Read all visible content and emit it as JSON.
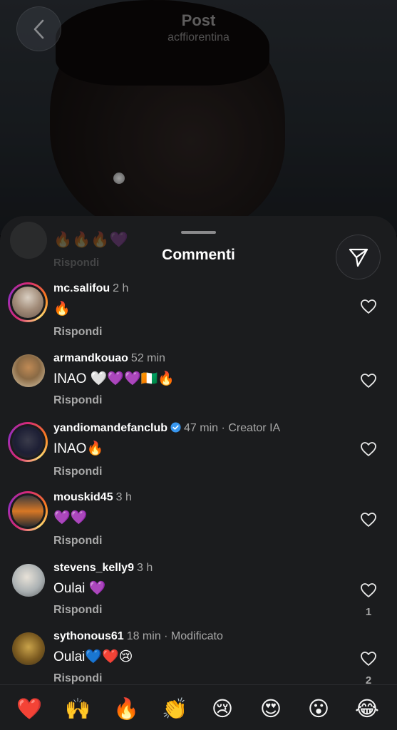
{
  "header": {
    "title": "Post",
    "subtitle": "acffiorentina"
  },
  "sheet": {
    "title": "Commenti",
    "ghost_emojis": "🔥🔥🔥💜",
    "ghost_reply": "Rispondi"
  },
  "comments": [
    {
      "username": "mc.salifou",
      "time": "2 h",
      "text": "🔥",
      "reply": "Rispondi",
      "likes": ""
    },
    {
      "username": "armandkouao",
      "time": "52 min",
      "text": "INAO 🤍💜💜🇨🇮🔥",
      "reply": "Rispondi",
      "likes": ""
    },
    {
      "username": "yandiomandefanclub",
      "time": "47 min · Creator IA",
      "text": "INAO🔥",
      "reply": "Rispondi",
      "likes": ""
    },
    {
      "username": "mouskid45",
      "time": "3 h",
      "text": "💜💜",
      "reply": "Rispondi",
      "likes": ""
    },
    {
      "username": "stevens_kelly9",
      "time": "3 h",
      "text": "Oulai 💜",
      "reply": "Rispondi",
      "likes": "1"
    },
    {
      "username": "sythonous61",
      "time": "18 min · Modificato",
      "text": "Oulai💙❤️😢",
      "reply": "Rispondi",
      "likes": "2"
    }
  ],
  "emoji_bar": [
    "❤️",
    "🙌",
    "🔥",
    "👏",
    "😢",
    "😍",
    "😮",
    "😂"
  ],
  "colors": {
    "sheet_bg": "#1b1c1e",
    "muted": "#a8a8a8",
    "verified": "#3897f0"
  }
}
